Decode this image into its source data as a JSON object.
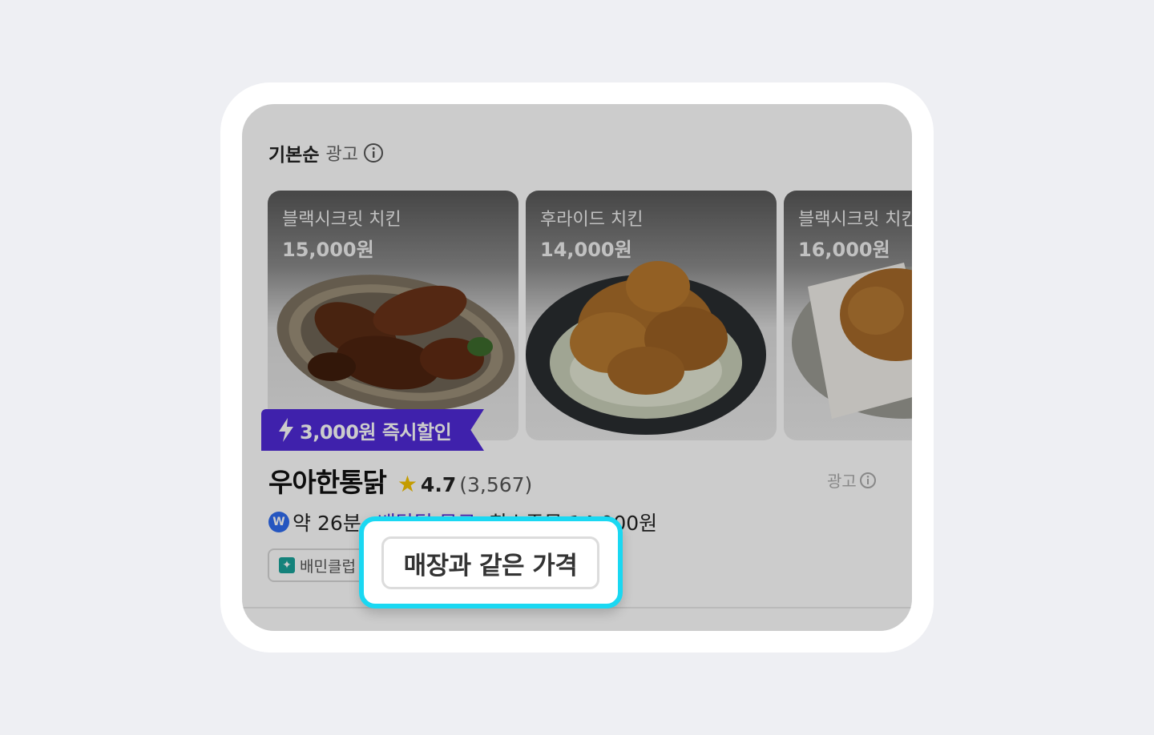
{
  "header": {
    "sort_label": "기본순",
    "ad_label": "광고"
  },
  "menu_cards": [
    {
      "name": "블랙시크릿 치킨",
      "price": "15,000원"
    },
    {
      "name": "후라이드 치킨",
      "price": "14,000원"
    },
    {
      "name": "블랙시크릿 치킨",
      "price": "16,000원"
    }
  ],
  "discount_badge": "3,000원 즉시할인",
  "store": {
    "name": "우아한통닭",
    "rating": "4.7",
    "review_count": "(3,567)",
    "ad_label": "광고",
    "delivery_time": "약 26분",
    "delivery_fee": "배달팁 무료",
    "min_order": "최소주문 14,000원",
    "club_tag": "배민클럽",
    "price_tag": "매장과 같은 가격"
  },
  "colors": {
    "background": "#eeeff3",
    "discount_badge": "#4f2ad8",
    "highlight_border": "#1ad8f2",
    "star": "#f6c400"
  }
}
